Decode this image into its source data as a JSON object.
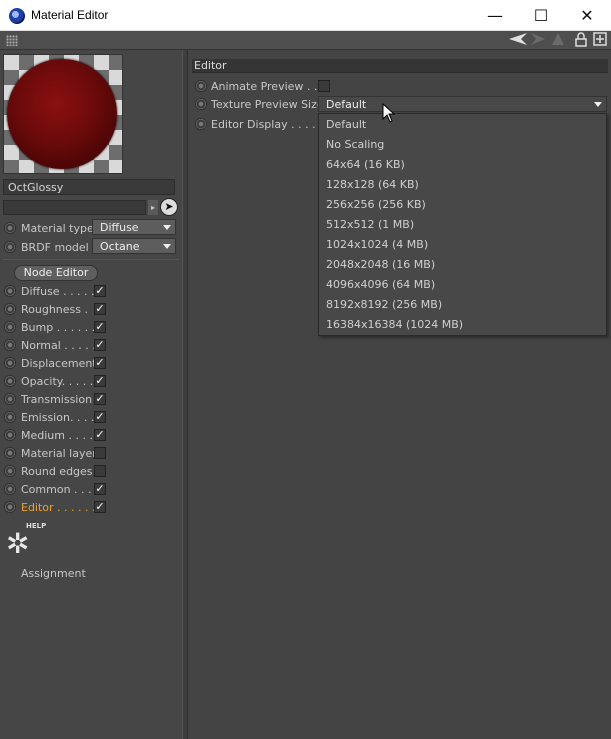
{
  "window": {
    "title": "Material Editor",
    "minimize": "—",
    "maximize": "☐",
    "close": "✕"
  },
  "toolbar": {
    "icons": [
      "back-arrow-icon",
      "forward-arrow-icon",
      "up-arrow-icon",
      "lock-icon",
      "new-window-icon"
    ]
  },
  "material": {
    "name": "OctGlossy",
    "link_value": ""
  },
  "basic": {
    "material_type_label": "Material type",
    "material_type_value": "Diffuse",
    "brdf_label": "BRDF model",
    "brdf_value": "Octane"
  },
  "node_editor_label": "Node Editor",
  "channels": [
    {
      "label": "Diffuse . . . . .",
      "checked": true
    },
    {
      "label": "Roughness  .",
      "checked": true
    },
    {
      "label": "Bump . . . . . .",
      "checked": true
    },
    {
      "label": "Normal . . . . .",
      "checked": true
    },
    {
      "label": "Displacement",
      "checked": true
    },
    {
      "label": "Opacity. . . . .",
      "checked": true
    },
    {
      "label": "Transmission",
      "checked": true
    },
    {
      "label": "Emission. . . .",
      "checked": true
    },
    {
      "label": "Medium . . . .",
      "checked": true
    },
    {
      "label": "Material layer",
      "checked": false
    },
    {
      "label": "Round edges",
      "checked": false
    },
    {
      "label": "Common . . .",
      "checked": true
    },
    {
      "label": "Editor . . . . . .",
      "checked": true,
      "active": true
    }
  ],
  "help": {
    "badge": "HELP",
    "assignment": "Assignment"
  },
  "editor": {
    "section_title": "Editor",
    "animate_preview_label": "Animate Preview . . .",
    "texture_preview_size_label": "Texture Preview Size",
    "texture_preview_size_value": "Default",
    "editor_display_label": "Editor Display . . . . .",
    "options": [
      "Default",
      "No Scaling",
      "64x64 (16 KB)",
      "128x128 (64 KB)",
      "256x256 (256 KB)",
      "512x512 (1 MB)",
      "1024x1024 (4 MB)",
      "2048x2048 (16 MB)",
      "4096x4096 (64 MB)",
      "8192x8192 (256 MB)",
      "16384x16384 (1024 MB)"
    ]
  }
}
